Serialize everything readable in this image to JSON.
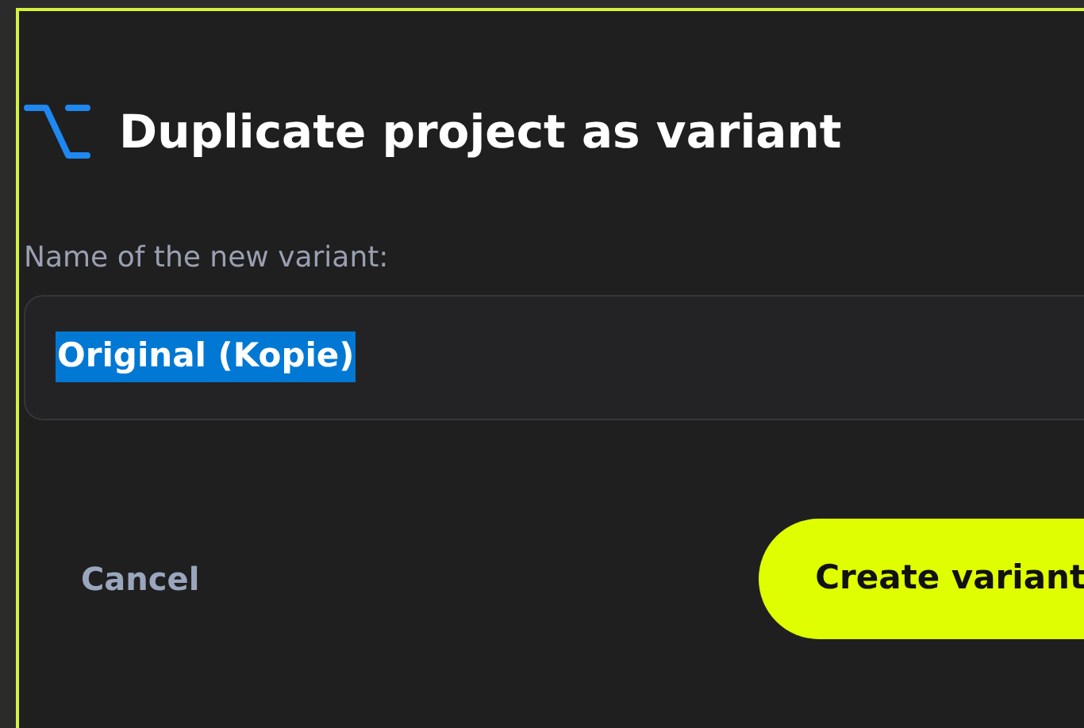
{
  "dialog": {
    "title": "Duplicate project as variant",
    "field": {
      "label": "Name of the new variant:",
      "value": "Original (Kopie)",
      "selected": true
    },
    "buttons": [
      {
        "label": "Cancel",
        "kind": "secondary"
      },
      {
        "label": "Create variant",
        "kind": "primary"
      }
    ]
  }
}
